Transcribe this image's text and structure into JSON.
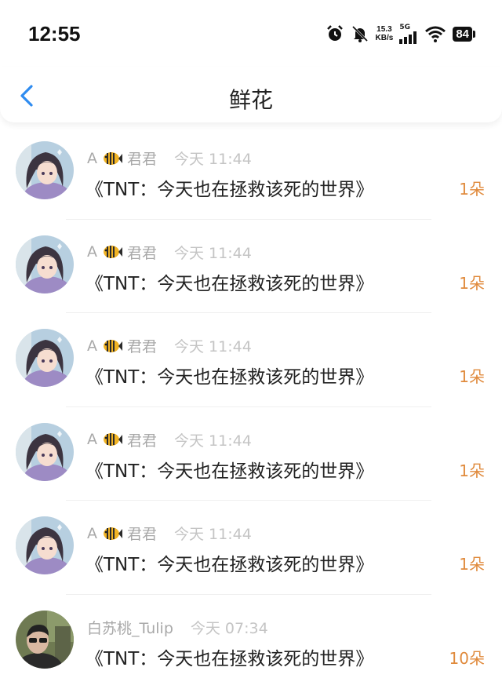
{
  "status_bar": {
    "time": "12:55",
    "speed_value": "15.3",
    "speed_unit": "KB/s",
    "network": "5G",
    "battery": "84"
  },
  "header": {
    "title": "鲜花"
  },
  "rows": [
    {
      "user": "A",
      "user_suffix": "君君",
      "time": "今天 11:44",
      "book": "《TNT：今天也在拯救该死的世界》",
      "count": "1朵",
      "avatar": "anime-girl"
    },
    {
      "user": "A",
      "user_suffix": "君君",
      "time": "今天 11:44",
      "book": "《TNT：今天也在拯救该死的世界》",
      "count": "1朵",
      "avatar": "anime-girl"
    },
    {
      "user": "A",
      "user_suffix": "君君",
      "time": "今天 11:44",
      "book": "《TNT：今天也在拯救该死的世界》",
      "count": "1朵",
      "avatar": "anime-girl"
    },
    {
      "user": "A",
      "user_suffix": "君君",
      "time": "今天 11:44",
      "book": "《TNT：今天也在拯救该死的世界》",
      "count": "1朵",
      "avatar": "anime-girl"
    },
    {
      "user": "A",
      "user_suffix": "君君",
      "time": "今天 11:44",
      "book": "《TNT：今天也在拯救该死的世界》",
      "count": "1朵",
      "avatar": "anime-girl"
    },
    {
      "user": "白苏桃_Tulip",
      "user_suffix": "",
      "time": "今天 07:34",
      "book": "《TNT：今天也在拯救该死的世界》",
      "count": "10朵",
      "avatar": "man-with-glasses"
    }
  ],
  "colors": {
    "accent_blue": "#2f8cf0",
    "count_orange": "#e08a3c",
    "name_gray": "#a9a9a9"
  }
}
